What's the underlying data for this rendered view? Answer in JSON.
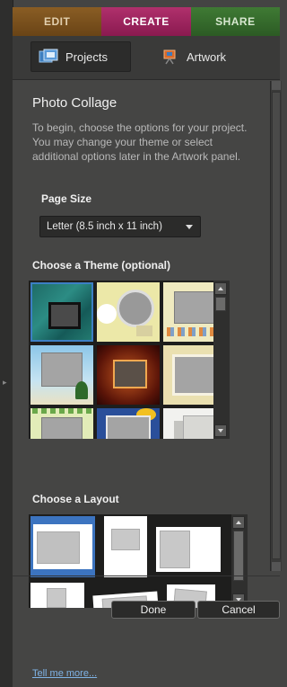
{
  "modes": {
    "edit": "EDIT",
    "create": "CREATE",
    "share": "SHARE"
  },
  "tabs": {
    "projects": "Projects",
    "artwork": "Artwork"
  },
  "panel": {
    "title": "Photo Collage",
    "intro": "To begin, choose the options for your project. You may change your theme or select additional options later in the Artwork panel.",
    "page_size_label": "Page Size",
    "page_size_value": "Letter (8.5 inch x 11 inch)",
    "theme_label": "Choose a Theme (optional)",
    "layout_label": "Choose a Layout"
  },
  "buttons": {
    "done": "Done",
    "cancel": "Cancel"
  },
  "footer": {
    "tell_me_more": "Tell me more..."
  },
  "colors": {
    "create_accent": "#a8286a",
    "edit_accent": "#7a5020",
    "share_accent": "#357030",
    "link": "#7fb3e6"
  }
}
